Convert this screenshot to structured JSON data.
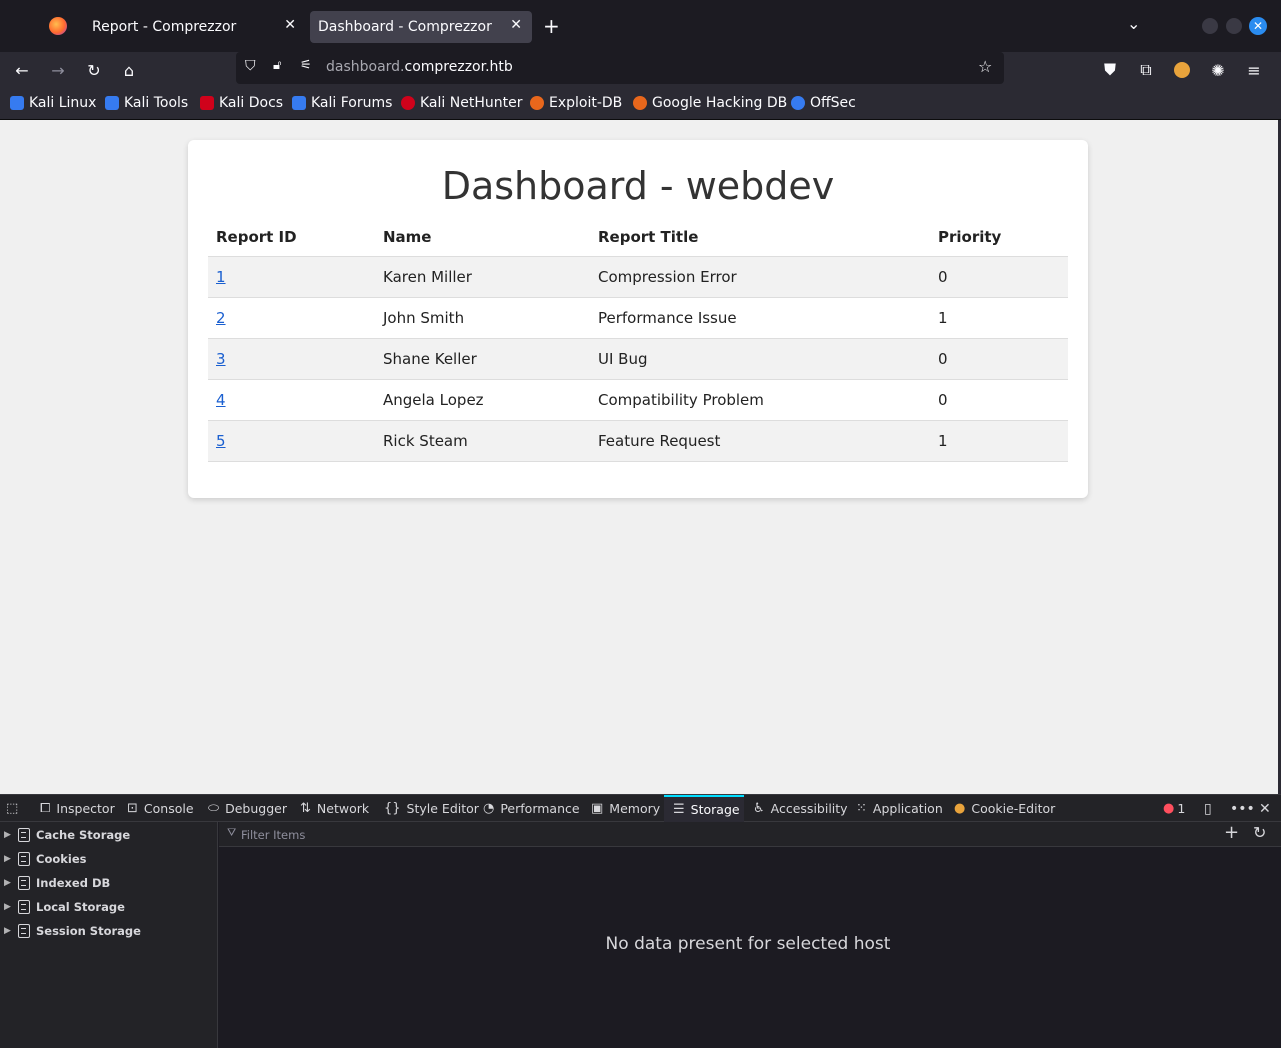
{
  "browser": {
    "tabs": [
      {
        "label": "Report - Comprezzor",
        "active": false
      },
      {
        "label": "Dashboard - Comprezzor",
        "active": true
      }
    ],
    "url": {
      "dim_part": "dashboard.",
      "main_part": "comprezzor.htb"
    },
    "bookmarks": [
      {
        "label": "Kali Linux",
        "color": "#367bf0"
      },
      {
        "label": "Kali Tools",
        "color": "#367bf0"
      },
      {
        "label": "Kali Docs",
        "color": "#d0021b"
      },
      {
        "label": "Kali Forums",
        "color": "#367bf0"
      },
      {
        "label": "Kali NetHunter",
        "color": "#d0021b"
      },
      {
        "label": "Exploit-DB",
        "color": "#e8671c"
      },
      {
        "label": "Google Hacking DB",
        "color": "#e8671c"
      },
      {
        "label": "OffSec",
        "color": "#367bf0"
      }
    ]
  },
  "page": {
    "title": "Dashboard - webdev",
    "columns": [
      "Report ID",
      "Name",
      "Report Title",
      "Priority"
    ],
    "rows": [
      {
        "id": "1",
        "name": "Karen Miller",
        "title": "Compression Error",
        "priority": "0"
      },
      {
        "id": "2",
        "name": "John Smith",
        "title": "Performance Issue",
        "priority": "1"
      },
      {
        "id": "3",
        "name": "Shane Keller",
        "title": "UI Bug",
        "priority": "0"
      },
      {
        "id": "4",
        "name": "Angela Lopez",
        "title": "Compatibility Problem",
        "priority": "0"
      },
      {
        "id": "5",
        "name": "Rick Steam",
        "title": "Feature Request",
        "priority": "1"
      }
    ]
  },
  "devtools": {
    "tabs": [
      "Inspector",
      "Console",
      "Debugger",
      "Network",
      "Style Editor",
      "Performance",
      "Memory",
      "Storage",
      "Accessibility",
      "Application",
      "Cookie-Editor"
    ],
    "selected_tab": "Storage",
    "error_count": "1",
    "storage_items": [
      "Cache Storage",
      "Cookies",
      "Indexed DB",
      "Local Storage",
      "Session Storage"
    ],
    "filter_placeholder": "Filter Items",
    "empty_message": "No data present for selected host"
  }
}
